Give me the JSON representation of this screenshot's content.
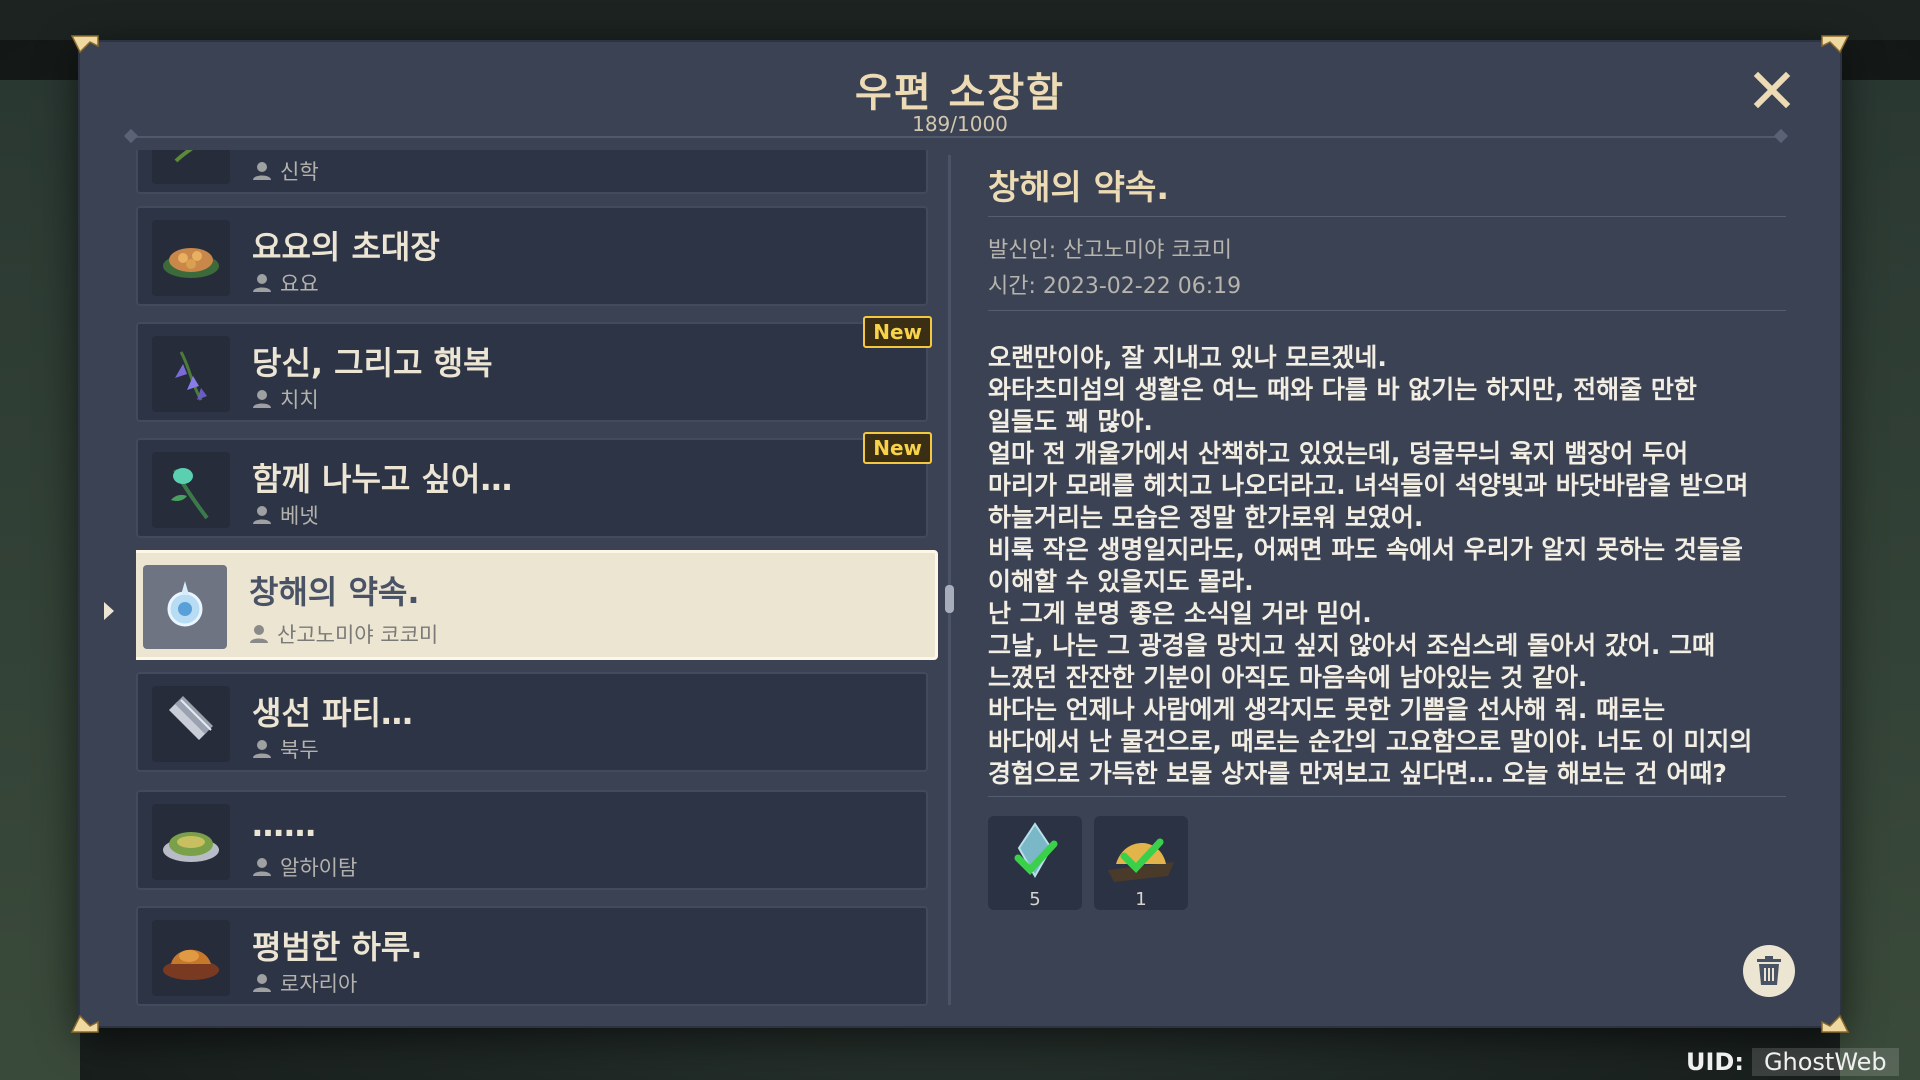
{
  "header": {
    "title": "우편 소장함",
    "count": "189/1000"
  },
  "mail_list": [
    {
      "title": "",
      "sender": "신학",
      "new": false,
      "icon": "herb-icon"
    },
    {
      "title": "요요의 초대장",
      "sender": "요요",
      "new": false,
      "icon": "dish-icon"
    },
    {
      "title": "당신, 그리고 행복",
      "sender": "치치",
      "new": true,
      "icon": "flower-icon"
    },
    {
      "title": "함께 나누고 싶어…",
      "sender": "베넷",
      "new": true,
      "icon": "plant-icon"
    },
    {
      "title": "창해의 약속.",
      "sender": "산고노미야 코코미",
      "new": false,
      "selected": true,
      "icon": "orb-icon"
    },
    {
      "title": "생선 파티…",
      "sender": "북두",
      "new": false,
      "icon": "fish-icon"
    },
    {
      "title": "……",
      "sender": "알하이탐",
      "new": false,
      "icon": "dish-icon"
    },
    {
      "title": "평범한 하루.",
      "sender": "로자리아",
      "new": false,
      "icon": "roast-icon"
    }
  ],
  "new_label": "New",
  "detail": {
    "title": "창해의 약속.",
    "sender": "발신인: 산고노미야 코코미",
    "time": "시간: 2023-02-22 06:19",
    "body_lines": [
      "오랜만이야, 잘 지내고 있나 모르겠네.",
      "와타츠미섬의 생활은 여느 때와 다를 바 없기는 하지만, 전해줄 만한",
      "일들도 꽤 많아.",
      "얼마 전 개울가에서 산책하고 있었는데, 덩굴무늬 육지 뱀장어 두어",
      "마리가 모래를 헤치고 나오더라고. 녀석들이 석양빛과 바닷바람을 받으며",
      "하늘거리는 모습은 정말 한가로워 보였어.",
      "비록 작은 생명일지라도, 어쩌면 파도 속에서 우리가 알지 못하는 것들을",
      "이해할 수 있을지도 몰라.",
      "난 그게 분명 좋은 소식일 거라 믿어.",
      "그날, 나는 그 광경을 망치고 싶지 않아서 조심스레 돌아서 갔어. 그때",
      "느꼈던 잔잔한 기분이 아직도 마음속에 남아있는 것 같아.",
      "바다는 언제나 사람에게 생각지도 못한 기쁨을 선사해 줘. 때로는",
      "바다에서 난 물건으로, 때로는 순간의 고요함으로 말이야. 너도 이 미지의",
      "경험으로 가득한 보물 상자를 만져보고 싶다면… 오늘 해보는 건 어때?"
    ],
    "attachments": [
      {
        "qty": "5",
        "icon": "crystal-icon",
        "claimed": true
      },
      {
        "qty": "1",
        "icon": "food-icon",
        "claimed": true
      }
    ]
  },
  "uid": {
    "label": "UID:",
    "value": "GhostWeb"
  }
}
